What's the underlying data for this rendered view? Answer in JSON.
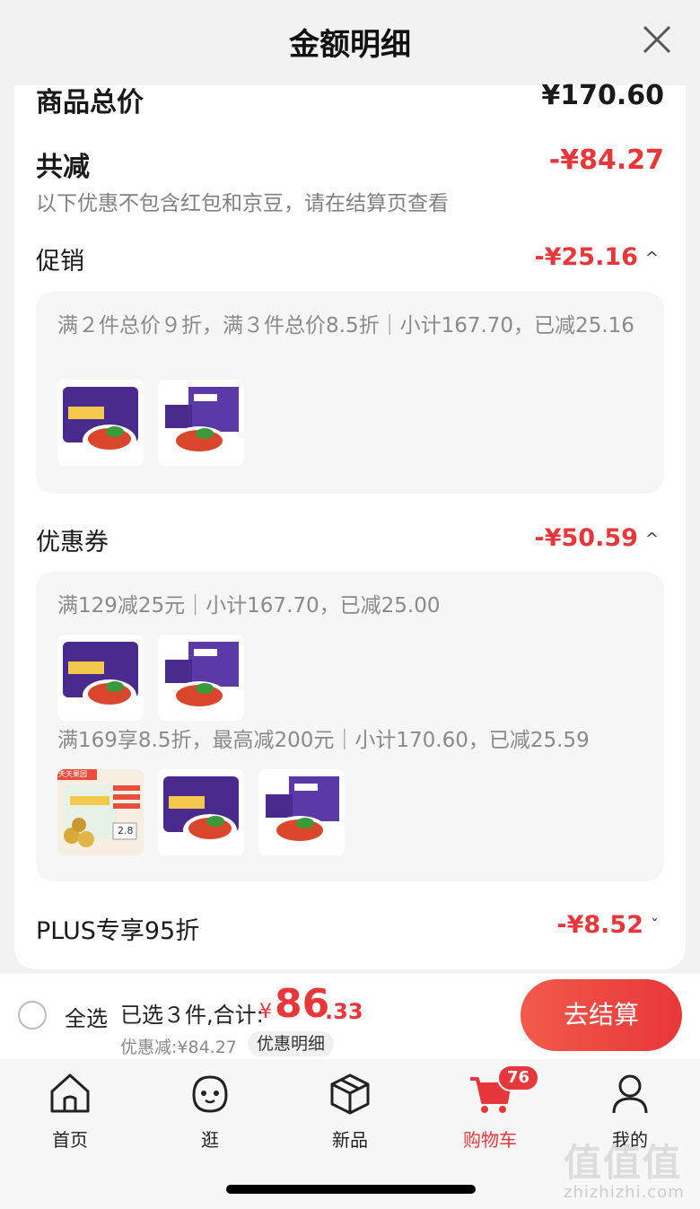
{
  "header": {
    "title": "金额明细"
  },
  "summary": {
    "total_label": "商品总价",
    "total_value": "¥170.60",
    "reduce_label": "共减",
    "reduce_value": "-¥84.27",
    "note": "以下优惠不包含红包和京豆，请在结算页查看"
  },
  "promotion": {
    "label": "促销",
    "value": "-¥25.16",
    "chevron": "^",
    "rule_text": "满２件总价９折，满３件总价8.5折｜小计167.70，已减25.16",
    "products": [
      "luosifen-bag",
      "luosifen-box"
    ]
  },
  "coupon": {
    "label": "优惠券",
    "value": "-¥50.59",
    "chevron": "^",
    "rule1_text": "满129减25元｜小计167.70，已减25.00",
    "rule1_products": [
      "luosifen-bag",
      "luosifen-box"
    ],
    "rule2_text": "满169享8.5折，最高减200元｜小计170.60，已减25.59",
    "rule2_products": [
      "chestnut-pack",
      "luosifen-bag",
      "luosifen-box"
    ],
    "chestnut_tag": "天天果园",
    "chestnut_price": "2.8"
  },
  "plus": {
    "label": "PLUS专享95折",
    "value": "-¥8.52",
    "chevron": "ˇ"
  },
  "checkout": {
    "select_all": "全选",
    "selected_text": "已选３件,合计:",
    "yen": "¥",
    "price_int": "86",
    "price_dec": ".33",
    "discount_text": "优惠减:¥84.27",
    "detail_chip": "优惠明细",
    "pay_button": "去结算"
  },
  "tabbar": {
    "items": [
      {
        "label": "首页",
        "icon": "home-icon"
      },
      {
        "label": "逛",
        "icon": "face-icon"
      },
      {
        "label": "新品",
        "icon": "box-icon"
      },
      {
        "label": "购物车",
        "icon": "cart-icon",
        "badge": "76",
        "active": true
      },
      {
        "label": "我的",
        "icon": "user-icon"
      }
    ]
  },
  "watermark": {
    "text": "值值值",
    "url": "zhizhizhi.com"
  },
  "colors": {
    "accent": "#e8373a",
    "muted": "#8a8a8a",
    "box_bg": "#f6f6f6"
  }
}
